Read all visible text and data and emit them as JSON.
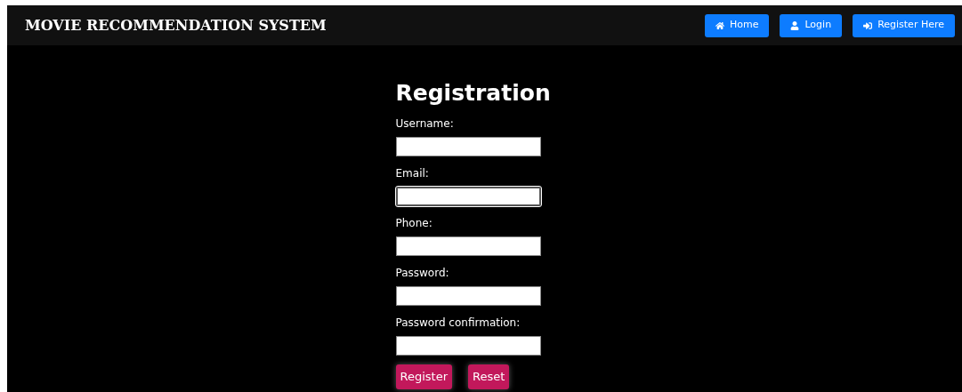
{
  "navbar": {
    "brand": "MOVIE RECOMMENDATION SYSTEM",
    "buttons": [
      {
        "label": "Home",
        "kind": "home"
      },
      {
        "label": "Login",
        "kind": "user"
      },
      {
        "label": "Register Here",
        "kind": "signin"
      }
    ]
  },
  "form": {
    "title": "Registration",
    "fields": [
      {
        "label": "Username:",
        "focused": false
      },
      {
        "label": "Email:",
        "focused": true
      },
      {
        "label": "Phone:",
        "focused": false
      },
      {
        "label": "Password:",
        "focused": false
      },
      {
        "label": "Password confirmation:",
        "focused": false
      }
    ],
    "buttons": [
      "Register",
      "Reset"
    ]
  }
}
